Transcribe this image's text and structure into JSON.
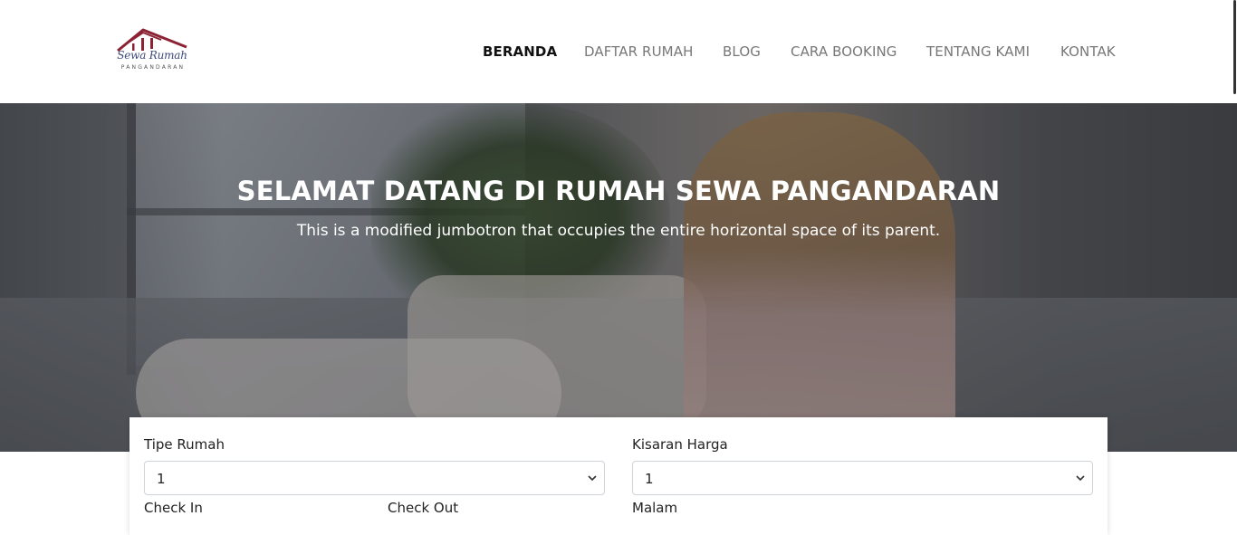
{
  "brand": {
    "logo_script": "Sewa Rumah",
    "logo_sub": "PANGANDARAN",
    "roof_color": "#8b2335"
  },
  "nav": {
    "items": [
      {
        "label": "BERANDA",
        "active": true
      },
      {
        "label": "DAFTAR RUMAH",
        "active": false
      },
      {
        "label": "BLOG",
        "active": false
      },
      {
        "label": "CARA BOOKING",
        "active": false
      },
      {
        "label": "TENTANG KAMI",
        "active": false
      },
      {
        "label": "KONTAK",
        "active": false
      }
    ]
  },
  "hero": {
    "title": "SELAMAT DATANG DI RUMAH SEWA PANGANDARAN",
    "lead": "This is a modified jumbotron that occupies the entire horizontal space of its parent."
  },
  "search": {
    "tipe_rumah_label": "Tipe Rumah",
    "tipe_rumah_value": "1",
    "kisaran_harga_label": "Kisaran Harga",
    "kisaran_harga_value": "1",
    "check_in_label": "Check In",
    "check_out_label": "Check Out",
    "malam_label": "Malam"
  }
}
